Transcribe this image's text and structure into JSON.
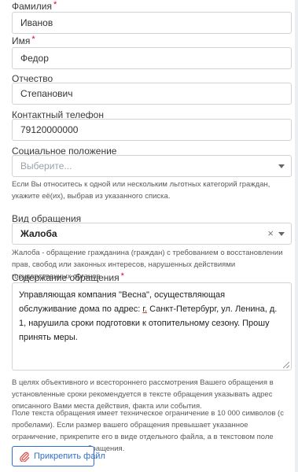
{
  "fields": {
    "surname": {
      "label": "Фамилия",
      "required_mark": "*",
      "value": "Иванов"
    },
    "name": {
      "label": "Имя",
      "required_mark": "*",
      "value": "Федор"
    },
    "patronymic": {
      "label": "Отчество",
      "value": "Степанович"
    },
    "phone": {
      "label": "Контактный телефон",
      "value": "79120000000"
    },
    "social": {
      "label": "Социальное положение",
      "placeholder": "Выберите...",
      "hint": "Если Вы относитесь к одной или нескольким льготных категорий граждан, укажите её(их), выбрав из указанного списка."
    },
    "appeal_type": {
      "label": "Вид обращения",
      "value": "Жалоба",
      "clear_glyph": "×",
      "hint": "Жалоба - обращение гражданина (граждан) с требованием о восстановлении прав, свобод или законных интересов, нарушенных действиями государственных органов"
    },
    "content": {
      "label": "Содержание обращения",
      "required_mark": "*",
      "text_before": "Управляющая компания \"Весна\", осуществляющая обслуживание дома по адрес: ",
      "text_underlined": "г.",
      "text_after": " Санкт-Петербург, ул. Ленина, д. 1, нарушила сроки подготовки к отопительному сезону. Прошу принять меры."
    }
  },
  "notes": {
    "note1": "В целях объективного и всестороннего рассмотрения Вашего обращения в установленные сроки рекомендуется в тексте обращения указывать адрес описанного Вами места действия, факта или события.",
    "note2": "Поле текста обращения имеет техническое ограничение в 10 000 символов (с пробелами). Если размер вашего обращения превышает указанное ограничение, прикрепите его в виде отдельного файла, а в текстовом поле кратко укажите суть обращения."
  },
  "attach_button": {
    "label": "Прикрепить файл",
    "icon": "paperclip-icon"
  },
  "colors": {
    "required": "#e4002b",
    "accent": "#2f6fd1",
    "border": "#cfd4d8"
  }
}
